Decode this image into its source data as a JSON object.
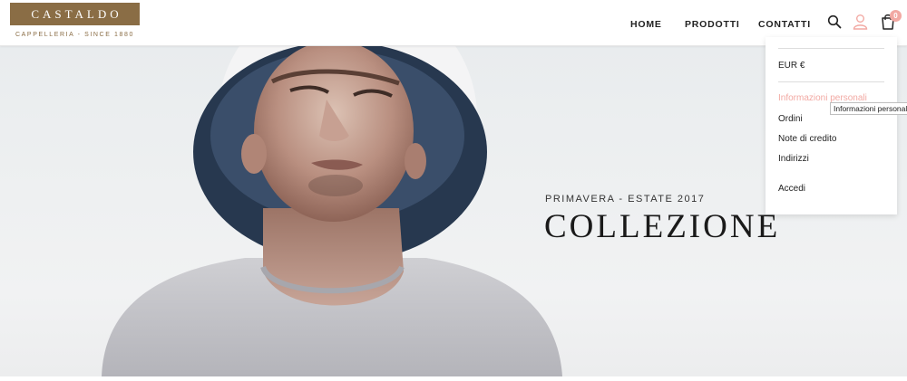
{
  "brand": {
    "name": "CASTALDO",
    "tagline": "CAPPELLERIA - SINCE 1880",
    "color": "#8a6d45"
  },
  "nav": {
    "items": [
      {
        "label": "HOME"
      },
      {
        "label": "PRODOTTI"
      },
      {
        "label": "CONTATTI"
      }
    ]
  },
  "header_icons": {
    "search": "search-icon",
    "user": "user-icon",
    "cart": "cart-icon",
    "cart_count": "0",
    "accent": "#f2a9a3"
  },
  "hero": {
    "subtitle": "PRIMAVERA - ESTATE 2017",
    "title": "COLLEZIONE"
  },
  "account_menu": {
    "currency": "EUR €",
    "items": [
      {
        "label": "Informazioni personali"
      },
      {
        "label": "Ordini"
      },
      {
        "label": "Note di credito"
      },
      {
        "label": "Indirizzi"
      }
    ],
    "login": "Accedi",
    "tooltip": "Informazioni personali"
  }
}
